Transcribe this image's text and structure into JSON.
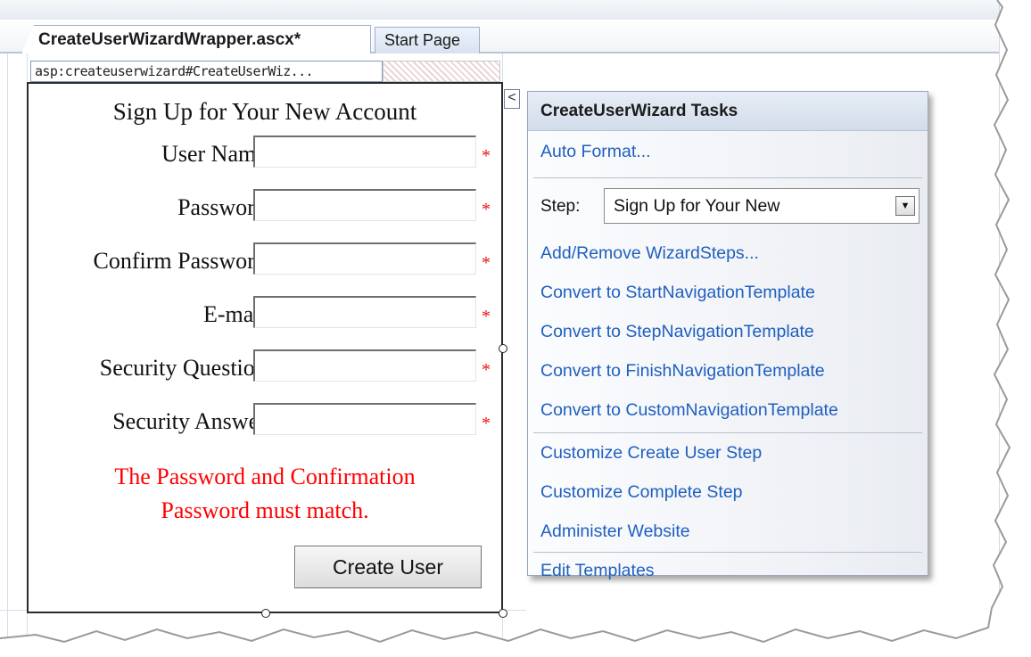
{
  "tabs": [
    {
      "label": "CreateUserWizardWrapper.ascx*",
      "active": true
    },
    {
      "label": "Start Page",
      "active": false
    }
  ],
  "control_tag": "asp:createuserwizard#CreateUserWiz...",
  "wizard": {
    "title": "Sign Up for Your New Account",
    "fields": [
      {
        "label": "User Name:",
        "required_marker": "*"
      },
      {
        "label": "Password:",
        "required_marker": "*"
      },
      {
        "label": "Confirm Password:",
        "required_marker": "*"
      },
      {
        "label": "E-mail:",
        "required_marker": "*"
      },
      {
        "label": "Security Question:",
        "required_marker": "*"
      },
      {
        "label": "Security Answer:",
        "required_marker": "*"
      }
    ],
    "error_line1": "The Password and Confirmation",
    "error_line2": "Password must match.",
    "create_button": "Create User"
  },
  "tasks": {
    "collapse_glyph": "<",
    "header": "CreateUserWizard Tasks",
    "auto_format": "Auto Format...",
    "step_label": "Step:",
    "step_value": "Sign Up for Your New",
    "dropdown_glyph": "▼",
    "links_group1": [
      "Add/Remove WizardSteps...",
      "Convert to StartNavigationTemplate",
      "Convert to StepNavigationTemplate",
      "Convert to FinishNavigationTemplate",
      "Convert to CustomNavigationTemplate"
    ],
    "links_group2": [
      "Customize Create User Step",
      "Customize Complete Step",
      "Administer Website"
    ],
    "edit_templates": "Edit Templates"
  },
  "colors": {
    "link": "#1f5fbf",
    "error": "#ff0000",
    "required": "#ee1111"
  }
}
